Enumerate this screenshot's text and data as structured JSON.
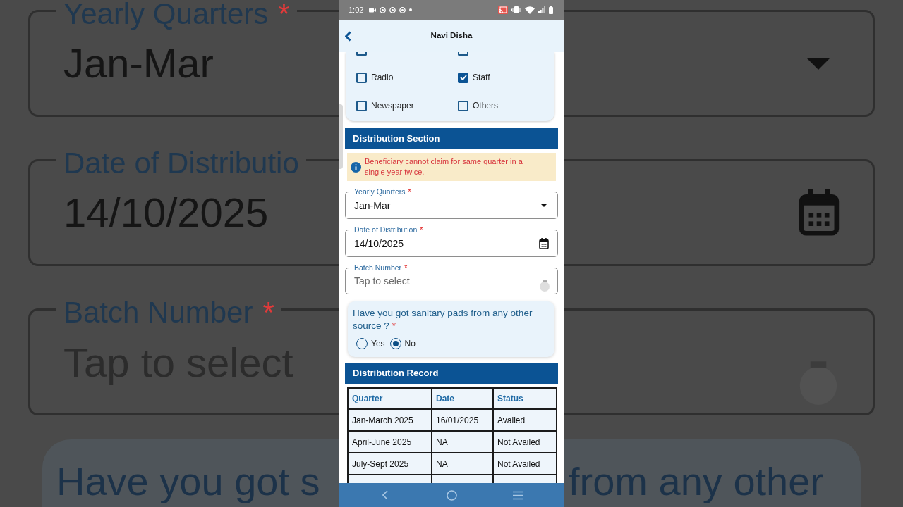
{
  "backdrop": {
    "fields": [
      {
        "label": "Yearly Quarters",
        "required_mark": "*",
        "value": "Jan-Mar",
        "kind": "dropdown"
      },
      {
        "label": "Date of Distributio",
        "value": "14/10/2025",
        "kind": "date"
      },
      {
        "label": "Batch Number",
        "required_mark": "*",
        "placeholder": "Tap to select",
        "kind": "loading"
      }
    ],
    "question_left": "Have you got s",
    "question_right": "from any other"
  },
  "status_bar": {
    "time": "1:02"
  },
  "app_bar": {
    "title": "Navi Disha"
  },
  "source_options": [
    {
      "kind": "clipped",
      "checked": false
    },
    {
      "kind": "clipped",
      "checked": false
    },
    {
      "kind": "option",
      "label": "Radio",
      "checked": false
    },
    {
      "kind": "option",
      "label": "Staff",
      "checked": true
    },
    {
      "kind": "option",
      "label": "Newspaper",
      "checked": false
    },
    {
      "kind": "option",
      "label": "Others",
      "checked": false
    }
  ],
  "distribution_section": {
    "title": "Distribution Section",
    "notice": "Beneficiary cannot claim for same quarter in a single year twice.",
    "fields": [
      {
        "label": "Yearly Quarters",
        "required_mark": "*",
        "value": "Jan-Mar",
        "kind": "dropdown"
      },
      {
        "label": "Date of Distribution",
        "required_mark": "*",
        "value": "14/10/2025",
        "kind": "date"
      },
      {
        "label": "Batch Number",
        "required_mark": "*",
        "placeholder": "Tap to select",
        "kind": "loading"
      }
    ],
    "question": {
      "text": "Have you got sanitary pads from any other source ?",
      "required_mark": "*",
      "options": [
        {
          "label": "Yes",
          "selected": false
        },
        {
          "label": "No",
          "selected": true
        }
      ]
    }
  },
  "distribution_record": {
    "title": "Distribution Record",
    "columns": [
      "Quarter",
      "Date",
      "Status"
    ],
    "rows": [
      [
        "Jan-March 2025",
        "16/01/2025",
        "Availed"
      ],
      [
        "April-June 2025",
        "NA",
        "Not Availed"
      ],
      [
        "July-Sept 2025",
        "NA",
        "Not Availed"
      ]
    ]
  }
}
